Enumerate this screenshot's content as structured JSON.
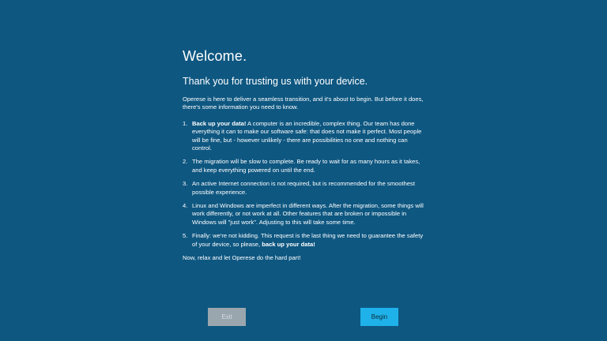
{
  "welcome": {
    "title": "Welcome.",
    "subtitle": "Thank you for trusting us with your device.",
    "intro": "Operese is here to deliver a seamless transition, and it's about to begin. But before it does, there's some information you need to know.",
    "items": [
      {
        "number": "1.",
        "bold_start": "Back up your data!",
        "text": " A computer is an incredible, complex thing. Our team has done everything it can to make our software safe: that does not make it perfect. Most people will be fine, but - however unlikely - there are possibilities no one and nothing can control.",
        "text_before_bold_end": "",
        "bold_end": ""
      },
      {
        "number": "2.",
        "bold_start": "",
        "text": "The migration will be slow to complete. Be ready to wait for as many hours as it takes, and keep everything powered on until the end.",
        "text_before_bold_end": "",
        "bold_end": ""
      },
      {
        "number": "3.",
        "bold_start": "",
        "text": "An active Internet connection is not required, but is recommended for the smoothest possible experience.",
        "text_before_bold_end": "",
        "bold_end": ""
      },
      {
        "number": "4.",
        "bold_start": "",
        "text": "Linux and Windows are imperfect in different ways. After the migration, some things will work differently, or not work at all. Other features that are broken or impossible in Windows will \"just work\". Adjusting to this will take some time.",
        "text_before_bold_end": "",
        "bold_end": ""
      },
      {
        "number": "5.",
        "bold_start": "",
        "text": "Finally: we're not kidding. This request is the last thing we need to guarantee the safety of your device, so please, ",
        "text_before_bold_end": "",
        "bold_end": "back up your data!"
      }
    ],
    "closing": "Now, relax and let Operese do the hard part!"
  },
  "buttons": {
    "exit_label": "Exit",
    "begin_label": "Begin"
  },
  "colors": {
    "background": "#0e5781",
    "exit_button": "#9aa6ae",
    "begin_button": "#1fb2ea"
  }
}
